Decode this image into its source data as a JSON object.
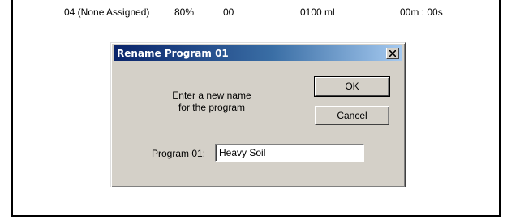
{
  "background_row": {
    "channel": "04 (None Assigned)",
    "percent": "80%",
    "code": "00",
    "volume": "0100 ml",
    "time": "00m : 00s"
  },
  "dialog": {
    "title": "Rename Program 01",
    "prompt_line1": "Enter a new name",
    "prompt_line2": "for the program",
    "ok_label": "OK",
    "cancel_label": "Cancel",
    "field_label": "Program 01:",
    "field_value": "Heavy Soil",
    "close_icon": "close-x-icon"
  },
  "colors": {
    "title_gradient_start": "#0a246a",
    "title_gradient_end": "#a6caf0",
    "dialog_face": "#d4d0c8"
  }
}
